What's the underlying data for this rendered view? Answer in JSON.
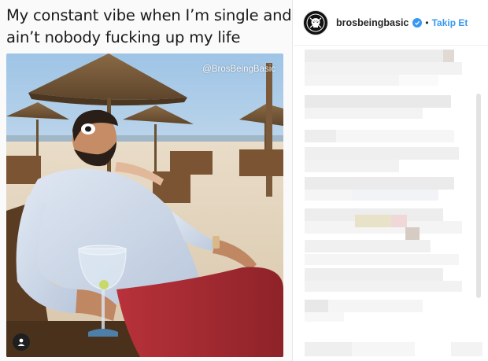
{
  "meme": {
    "caption_line1": "My constant vibe when I’m single and",
    "caption_line2": "ain’t nobody fucking up my life",
    "watermark": "@BrosBeingBasic"
  },
  "post": {
    "username": "brosbeingbasic",
    "separator": "•",
    "follow_label": "Takip Et",
    "verified_color": "#3897f0",
    "follow_color": "#3897f0"
  },
  "icons": {
    "avatar": "skull-logo-icon",
    "verified": "verified-badge-icon",
    "profile": "user-profile-icon"
  }
}
